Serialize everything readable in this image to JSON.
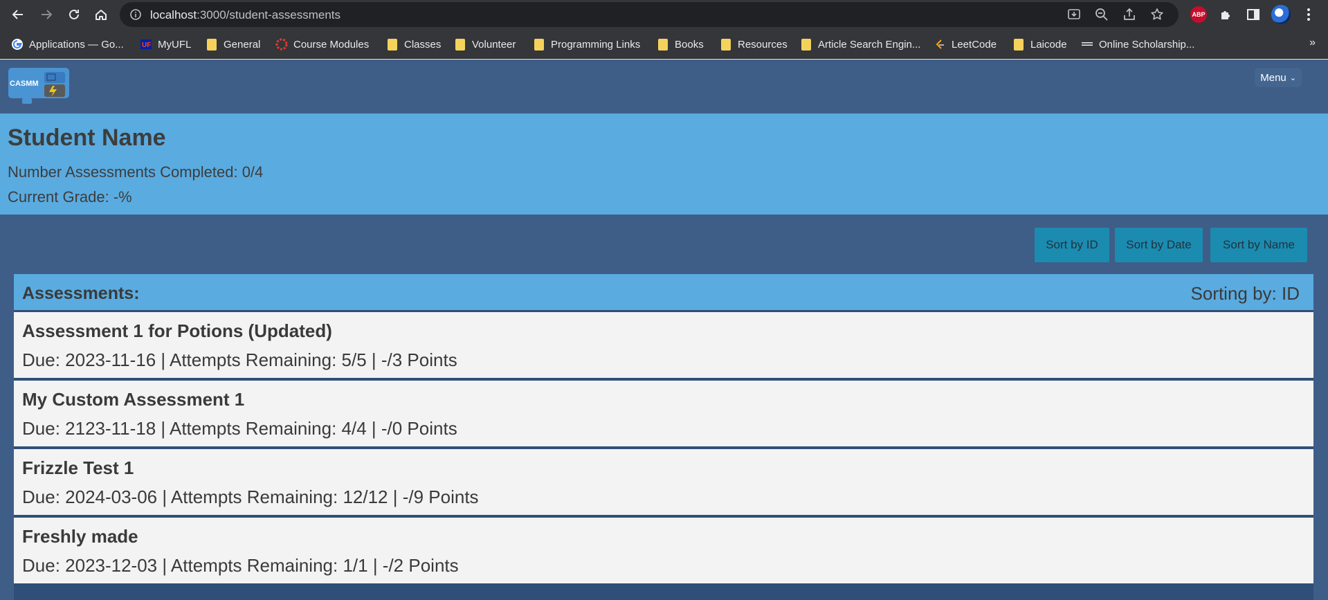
{
  "browser": {
    "url_host": "localhost",
    "url_path": ":3000/student-assessments",
    "extensions": {
      "abp_label": "ABP"
    },
    "bookmarks": [
      {
        "label": "Applications — Go...",
        "icon": "google-icon"
      },
      {
        "label": "MyUFL",
        "icon": "uf-icon"
      },
      {
        "label": "General",
        "icon": "folder-icon"
      },
      {
        "label": "Course Modules",
        "icon": "canvas-icon"
      },
      {
        "label": "Classes",
        "icon": "folder-icon"
      },
      {
        "label": "Volunteer",
        "icon": "folder-icon"
      },
      {
        "label": "Programming Links",
        "icon": "folder-icon"
      },
      {
        "label": "Books",
        "icon": "folder-icon"
      },
      {
        "label": "Resources",
        "icon": "folder-icon"
      },
      {
        "label": "Article Search Engin...",
        "icon": "folder-icon"
      },
      {
        "label": "LeetCode",
        "icon": "leetcode-icon"
      },
      {
        "label": "Laicode",
        "icon": "folder-icon"
      },
      {
        "label": "Online Scholarship...",
        "icon": "site-icon"
      }
    ],
    "bookmarks_more": "»"
  },
  "app": {
    "logo_text": "CASMM",
    "menu_label": "Menu"
  },
  "student": {
    "name": "Student Name",
    "completed": "Number Assessments Completed: 0/4",
    "grade": "Current Grade: -%"
  },
  "sort_buttons": [
    "Sort by ID",
    "Sort by Date",
    "Sort by Name"
  ],
  "assessments": {
    "title": "Assessments:",
    "sorting": "Sorting by: ID",
    "items": [
      {
        "name": "Assessment 1 for Potions (Updated)",
        "meta": "Due: 2023-11-16 | Attempts Remaining: 5/5 | -/3 Points"
      },
      {
        "name": "My Custom Assessment 1",
        "meta": "Due: 2123-11-18 | Attempts Remaining: 4/4 | -/0 Points"
      },
      {
        "name": "Frizzle Test 1",
        "meta": "Due: 2024-03-06 | Attempts Remaining: 12/12 | -/9 Points"
      },
      {
        "name": "Freshly made",
        "meta": "Due: 2023-12-03 | Attempts Remaining: 1/1 | -/2 Points"
      }
    ]
  },
  "colors": {
    "chrome_bg": "#35363a",
    "app_bg": "#3f5e87",
    "panel_blue": "#5aabdf",
    "button_teal": "#1b8bb0",
    "row_bg": "#f3f3f3"
  }
}
